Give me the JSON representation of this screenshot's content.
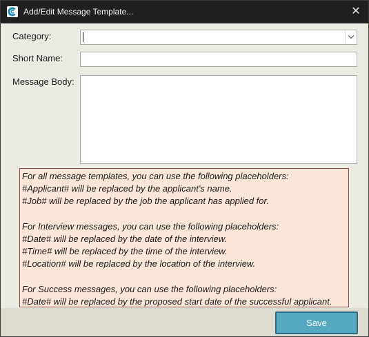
{
  "window": {
    "title": "Add/Edit Message Template...",
    "app_icon": "app-logo-icon",
    "close_glyph": "✕"
  },
  "form": {
    "category_label": "Category:",
    "category_value": "",
    "short_name_label": "Short Name:",
    "short_name_value": "",
    "message_body_label": "Message Body:",
    "message_body_value": ""
  },
  "info": {
    "lines": [
      "For all message templates, you can use the following placeholders:",
      "#Applicant# will be replaced by the applicant's name.",
      "#Job# will be replaced by the job the applicant has applied for.",
      "",
      "For Interview messages, you can use the following placeholders:",
      "#Date# will be replaced by the date of the interview.",
      "#Time# will be replaced by the time of the interview.",
      "#Location# will be replaced by the location of the interview.",
      "",
      "For Success messages, you can use the following placeholders:",
      "#Date# will be replaced by the proposed start date of the successful applicant."
    ]
  },
  "footer": {
    "save_label": "Save"
  },
  "colors": {
    "titlebar": "#202020",
    "dialog_bg": "#ecebe3",
    "info_bg": "#fbe6d9",
    "info_border": "#8a4a4a",
    "save_bg": "#55a9c1",
    "save_border": "#2e6c82"
  }
}
